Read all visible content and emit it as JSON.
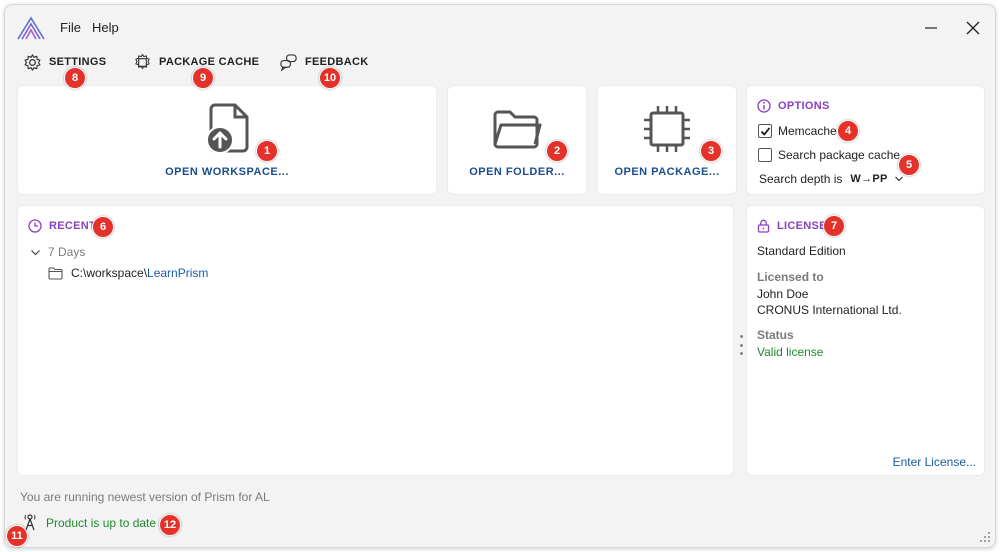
{
  "menu": {
    "file": "File",
    "help": "Help"
  },
  "toolbar": {
    "settings": "SETTINGS",
    "package_cache": "PACKAGE CACHE",
    "feedback": "FEEDBACK"
  },
  "actions": {
    "open_workspace": "OPEN WORKSPACE...",
    "open_folder": "OPEN FOLDER...",
    "open_package": "OPEN PACKAGE..."
  },
  "options": {
    "title": "OPTIONS",
    "memcache_label": "Memcache",
    "memcache_checked": true,
    "search_cache_label": "Search package cache",
    "search_cache_checked": false,
    "depth_label": "Search depth is",
    "depth_value": "W→PP"
  },
  "recent": {
    "title": "RECENT",
    "group": "7 Days",
    "items": [
      {
        "path_prefix": "C:\\workspace\\",
        "name": "LearnPrism"
      }
    ]
  },
  "license": {
    "title": "LICENSE",
    "edition": "Standard Edition",
    "licensed_to_label": "Licensed to",
    "licensee_name": "John Doe",
    "licensee_company": "CRONUS International Ltd.",
    "status_label": "Status",
    "status_value": "Valid license",
    "enter_link": "Enter License..."
  },
  "status_bar": {
    "version_text": "You are running newest version of Prism for AL",
    "update_status": "Product is up to date"
  },
  "callouts": [
    "1",
    "2",
    "3",
    "4",
    "5",
    "6",
    "7",
    "8",
    "9",
    "10",
    "11",
    "12"
  ],
  "colors": {
    "accent_purple": "#8a3fbf",
    "link_blue": "#1a5aa6",
    "action_blue": "#1a4f8b",
    "ok_green": "#1f8a2e",
    "callout_red": "#e4322b"
  },
  "icons": [
    "app-logo-icon",
    "minimize-icon",
    "close-icon",
    "gear-icon",
    "package-gear-icon",
    "feedback-icon",
    "file-upload-icon",
    "folder-icon",
    "chip-icon",
    "info-icon",
    "clock-icon",
    "chevron-down-icon",
    "lock-icon",
    "antenna-icon",
    "resize-grip-icon"
  ]
}
